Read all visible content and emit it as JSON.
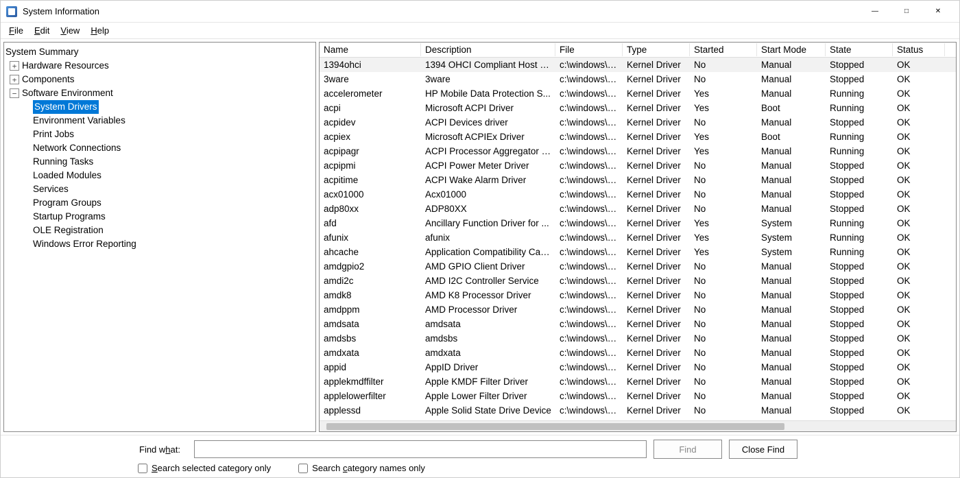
{
  "window": {
    "title": "System Information"
  },
  "menu": {
    "file": "File",
    "edit": "Edit",
    "view": "View",
    "help": "Help"
  },
  "tree": {
    "root": "System Summary",
    "hw": "Hardware Resources",
    "comp": "Components",
    "swenv": "Software Environment",
    "swenv_children": [
      "System Drivers",
      "Environment Variables",
      "Print Jobs",
      "Network Connections",
      "Running Tasks",
      "Loaded Modules",
      "Services",
      "Program Groups",
      "Startup Programs",
      "OLE Registration",
      "Windows Error Reporting"
    ],
    "selected": "System Drivers"
  },
  "columns": {
    "name": "Name",
    "description": "Description",
    "file": "File",
    "type": "Type",
    "started": "Started",
    "startmode": "Start Mode",
    "state": "State",
    "status": "Status"
  },
  "rows": [
    {
      "name": "1394ohci",
      "desc": "1394 OHCI Compliant Host C...",
      "file": "c:\\windows\\s...",
      "type": "Kernel Driver",
      "started": "No",
      "startmode": "Manual",
      "state": "Stopped",
      "status": "OK"
    },
    {
      "name": "3ware",
      "desc": "3ware",
      "file": "c:\\windows\\s...",
      "type": "Kernel Driver",
      "started": "No",
      "startmode": "Manual",
      "state": "Stopped",
      "status": "OK"
    },
    {
      "name": "accelerometer",
      "desc": "HP Mobile Data Protection S...",
      "file": "c:\\windows\\s...",
      "type": "Kernel Driver",
      "started": "Yes",
      "startmode": "Manual",
      "state": "Running",
      "status": "OK"
    },
    {
      "name": "acpi",
      "desc": "Microsoft ACPI Driver",
      "file": "c:\\windows\\s...",
      "type": "Kernel Driver",
      "started": "Yes",
      "startmode": "Boot",
      "state": "Running",
      "status": "OK"
    },
    {
      "name": "acpidev",
      "desc": "ACPI Devices driver",
      "file": "c:\\windows\\s...",
      "type": "Kernel Driver",
      "started": "No",
      "startmode": "Manual",
      "state": "Stopped",
      "status": "OK"
    },
    {
      "name": "acpiex",
      "desc": "Microsoft ACPIEx Driver",
      "file": "c:\\windows\\s...",
      "type": "Kernel Driver",
      "started": "Yes",
      "startmode": "Boot",
      "state": "Running",
      "status": "OK"
    },
    {
      "name": "acpipagr",
      "desc": "ACPI Processor Aggregator D...",
      "file": "c:\\windows\\s...",
      "type": "Kernel Driver",
      "started": "Yes",
      "startmode": "Manual",
      "state": "Running",
      "status": "OK"
    },
    {
      "name": "acpipmi",
      "desc": "ACPI Power Meter Driver",
      "file": "c:\\windows\\s...",
      "type": "Kernel Driver",
      "started": "No",
      "startmode": "Manual",
      "state": "Stopped",
      "status": "OK"
    },
    {
      "name": "acpitime",
      "desc": "ACPI Wake Alarm Driver",
      "file": "c:\\windows\\s...",
      "type": "Kernel Driver",
      "started": "No",
      "startmode": "Manual",
      "state": "Stopped",
      "status": "OK"
    },
    {
      "name": "acx01000",
      "desc": "Acx01000",
      "file": "c:\\windows\\s...",
      "type": "Kernel Driver",
      "started": "No",
      "startmode": "Manual",
      "state": "Stopped",
      "status": "OK"
    },
    {
      "name": "adp80xx",
      "desc": "ADP80XX",
      "file": "c:\\windows\\s...",
      "type": "Kernel Driver",
      "started": "No",
      "startmode": "Manual",
      "state": "Stopped",
      "status": "OK"
    },
    {
      "name": "afd",
      "desc": "Ancillary Function Driver for ...",
      "file": "c:\\windows\\s...",
      "type": "Kernel Driver",
      "started": "Yes",
      "startmode": "System",
      "state": "Running",
      "status": "OK"
    },
    {
      "name": "afunix",
      "desc": "afunix",
      "file": "c:\\windows\\s...",
      "type": "Kernel Driver",
      "started": "Yes",
      "startmode": "System",
      "state": "Running",
      "status": "OK"
    },
    {
      "name": "ahcache",
      "desc": "Application Compatibility Cac...",
      "file": "c:\\windows\\s...",
      "type": "Kernel Driver",
      "started": "Yes",
      "startmode": "System",
      "state": "Running",
      "status": "OK"
    },
    {
      "name": "amdgpio2",
      "desc": "AMD GPIO Client Driver",
      "file": "c:\\windows\\s...",
      "type": "Kernel Driver",
      "started": "No",
      "startmode": "Manual",
      "state": "Stopped",
      "status": "OK"
    },
    {
      "name": "amdi2c",
      "desc": "AMD I2C Controller Service",
      "file": "c:\\windows\\s...",
      "type": "Kernel Driver",
      "started": "No",
      "startmode": "Manual",
      "state": "Stopped",
      "status": "OK"
    },
    {
      "name": "amdk8",
      "desc": "AMD K8 Processor Driver",
      "file": "c:\\windows\\s...",
      "type": "Kernel Driver",
      "started": "No",
      "startmode": "Manual",
      "state": "Stopped",
      "status": "OK"
    },
    {
      "name": "amdppm",
      "desc": "AMD Processor Driver",
      "file": "c:\\windows\\s...",
      "type": "Kernel Driver",
      "started": "No",
      "startmode": "Manual",
      "state": "Stopped",
      "status": "OK"
    },
    {
      "name": "amdsata",
      "desc": "amdsata",
      "file": "c:\\windows\\s...",
      "type": "Kernel Driver",
      "started": "No",
      "startmode": "Manual",
      "state": "Stopped",
      "status": "OK"
    },
    {
      "name": "amdsbs",
      "desc": "amdsbs",
      "file": "c:\\windows\\s...",
      "type": "Kernel Driver",
      "started": "No",
      "startmode": "Manual",
      "state": "Stopped",
      "status": "OK"
    },
    {
      "name": "amdxata",
      "desc": "amdxata",
      "file": "c:\\windows\\s...",
      "type": "Kernel Driver",
      "started": "No",
      "startmode": "Manual",
      "state": "Stopped",
      "status": "OK"
    },
    {
      "name": "appid",
      "desc": "AppID Driver",
      "file": "c:\\windows\\s...",
      "type": "Kernel Driver",
      "started": "No",
      "startmode": "Manual",
      "state": "Stopped",
      "status": "OK"
    },
    {
      "name": "applekmdffilter",
      "desc": "Apple KMDF Filter Driver",
      "file": "c:\\windows\\s...",
      "type": "Kernel Driver",
      "started": "No",
      "startmode": "Manual",
      "state": "Stopped",
      "status": "OK"
    },
    {
      "name": "applelowerfilter",
      "desc": "Apple Lower Filter Driver",
      "file": "c:\\windows\\s...",
      "type": "Kernel Driver",
      "started": "No",
      "startmode": "Manual",
      "state": "Stopped",
      "status": "OK"
    },
    {
      "name": "applessd",
      "desc": "Apple Solid State Drive Device",
      "file": "c:\\windows\\s...",
      "type": "Kernel Driver",
      "started": "No",
      "startmode": "Manual",
      "state": "Stopped",
      "status": "OK"
    }
  ],
  "find": {
    "label_prefix": "Find w",
    "label_ul": "h",
    "label_suffix": "at:",
    "value": "",
    "placeholder": "",
    "find_btn": "Find",
    "close_btn": "Close Find",
    "cb1_prefix": "",
    "cb1_ul": "S",
    "cb1_suffix": "earch selected category only",
    "cb2_prefix": "Search ",
    "cb2_ul": "c",
    "cb2_suffix": "ategory names only"
  }
}
